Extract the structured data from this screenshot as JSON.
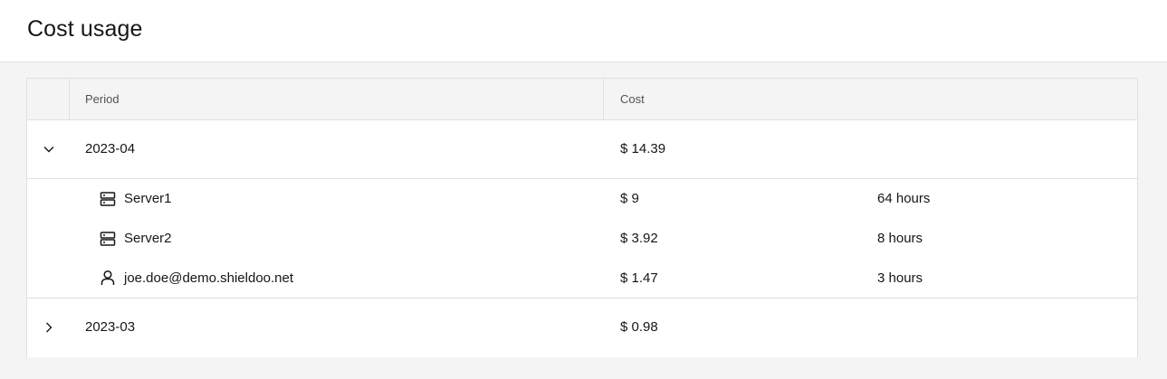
{
  "page": {
    "title": "Cost usage"
  },
  "table": {
    "columns": {
      "period": "Period",
      "cost": "Cost"
    },
    "groups": [
      {
        "period": "2023-04",
        "cost": "$ 14.39",
        "expanded": true,
        "items": [
          {
            "icon": "server-icon",
            "name": "Server1",
            "cost": "$ 9",
            "hours": "64 hours"
          },
          {
            "icon": "server-icon",
            "name": "Server2",
            "cost": "$ 3.92",
            "hours": "8 hours"
          },
          {
            "icon": "user-icon",
            "name": "joe.doe@demo.shieldoo.net",
            "cost": "$ 1.47",
            "hours": "3 hours"
          }
        ]
      },
      {
        "period": "2023-03",
        "cost": "$ 0.98",
        "expanded": false,
        "items": []
      }
    ]
  }
}
